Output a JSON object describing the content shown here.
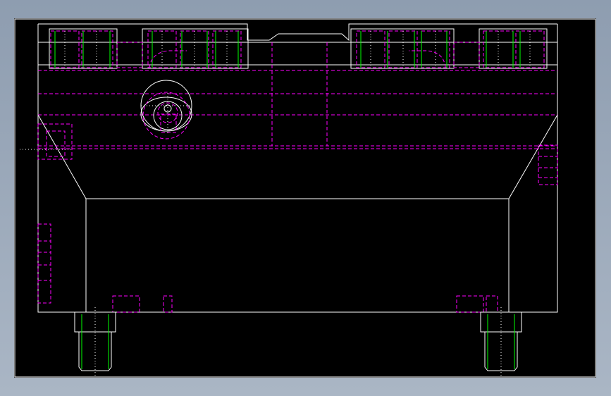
{
  "colors": {
    "background": "#000000",
    "frame": "#9aa7b8",
    "outline": "#ffffff",
    "hidden_lines": "#ff00ff",
    "thread_lines": "#00ff00"
  },
  "view": {
    "type": "cad-drawing",
    "subject": "mold-block-front-view"
  }
}
